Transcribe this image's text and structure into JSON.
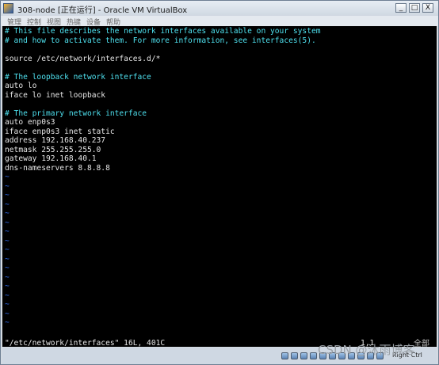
{
  "window": {
    "title": "308-node [正在运行] - Oracle VM VirtualBox",
    "controls": {
      "minimize": "_",
      "maximize": "□",
      "close": "X"
    }
  },
  "menubar": {
    "items": [
      "管理",
      "控制",
      "视图",
      "热键",
      "设备",
      "帮助"
    ]
  },
  "terminal": {
    "lines": [
      {
        "text": "# This file describes the network interfaces available on your system",
        "color": "cyan"
      },
      {
        "text": "# and how to activate them. For more information, see interfaces(5).",
        "color": "cyan"
      },
      {
        "text": "",
        "color": "white"
      },
      {
        "text": "source /etc/network/interfaces.d/*",
        "color": "white"
      },
      {
        "text": "",
        "color": "white"
      },
      {
        "text": "# The loopback network interface",
        "color": "cyan"
      },
      {
        "text": "auto lo",
        "color": "white"
      },
      {
        "text": "iface lo inet loopback",
        "color": "white"
      },
      {
        "text": "",
        "color": "white"
      },
      {
        "text": "# The primary network interface",
        "color": "cyan"
      },
      {
        "text": "auto enp0s3",
        "color": "white"
      },
      {
        "text": "iface enp0s3 inet static",
        "color": "white"
      },
      {
        "text": "address 192.168.40.237",
        "color": "white"
      },
      {
        "text": "netmask 255.255.255.0",
        "color": "white"
      },
      {
        "text": "gateway 192.168.40.1",
        "color": "white"
      },
      {
        "text": "dns-nameservers 8.8.8.8",
        "color": "white"
      }
    ],
    "empty_line_marker": "~",
    "status_file": "\"/etc/network/interfaces\" 16L, 401C",
    "cursor_position": "1,1",
    "scroll_position": "全部"
  },
  "statusbar": {
    "host_key": "Right Ctrl"
  },
  "watermark": "CSDN @沐雨博客",
  "colors": {
    "cyan": "#4ee0ee",
    "white": "#e6e6e6",
    "tilde": "#2e6cf0",
    "screen_bg": "#000000"
  }
}
